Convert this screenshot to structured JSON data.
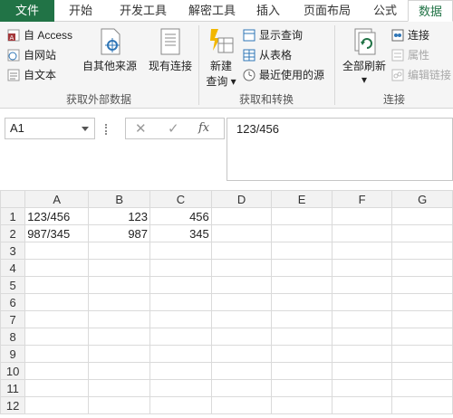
{
  "tabs": [
    "文件",
    "开始",
    "开发工具",
    "解密工具",
    "插入",
    "页面布局",
    "公式",
    "数据"
  ],
  "ribbon": {
    "group1": {
      "label": "获取外部数据",
      "access": "自 Access",
      "web": "自网站",
      "text": "自文本",
      "other": "自其他来源",
      "existing": "现有连接"
    },
    "group2": {
      "label": "获取和转换",
      "new_query": "新建",
      "new_query2": "查询",
      "show_queries": "显示查询",
      "from_table": "从表格",
      "recent": "最近使用的源"
    },
    "group3": {
      "label": "连接",
      "refresh_all": "全部刷新",
      "connections": "连接",
      "properties": "属性",
      "edit_links": "编辑链接"
    }
  },
  "formula_bar": {
    "name_box": "A1",
    "cancel": "✕",
    "enter": "✓",
    "fx": "fx",
    "content": "123/456"
  },
  "sheet": {
    "columns": [
      "A",
      "B",
      "C",
      "D",
      "E",
      "F",
      "G"
    ],
    "rows": [
      {
        "n": "1",
        "cells": [
          "123/456",
          "123",
          "456",
          "",
          "",
          "",
          ""
        ]
      },
      {
        "n": "2",
        "cells": [
          "987/345",
          "987",
          "345",
          "",
          "",
          "",
          ""
        ]
      },
      {
        "n": "3",
        "cells": [
          "",
          "",
          "",
          "",
          "",
          "",
          ""
        ]
      },
      {
        "n": "4",
        "cells": [
          "",
          "",
          "",
          "",
          "",
          "",
          ""
        ]
      },
      {
        "n": "5",
        "cells": [
          "",
          "",
          "",
          "",
          "",
          "",
          ""
        ]
      },
      {
        "n": "6",
        "cells": [
          "",
          "",
          "",
          "",
          "",
          "",
          ""
        ]
      },
      {
        "n": "7",
        "cells": [
          "",
          "",
          "",
          "",
          "",
          "",
          ""
        ]
      },
      {
        "n": "8",
        "cells": [
          "",
          "",
          "",
          "",
          "",
          "",
          ""
        ]
      },
      {
        "n": "9",
        "cells": [
          "",
          "",
          "",
          "",
          "",
          "",
          ""
        ]
      },
      {
        "n": "10",
        "cells": [
          "",
          "",
          "",
          "",
          "",
          "",
          ""
        ]
      },
      {
        "n": "11",
        "cells": [
          "",
          "",
          "",
          "",
          "",
          "",
          ""
        ]
      },
      {
        "n": "12",
        "cells": [
          "",
          "",
          "",
          "",
          "",
          "",
          ""
        ]
      }
    ]
  },
  "colors": {
    "accent": "#217346"
  }
}
